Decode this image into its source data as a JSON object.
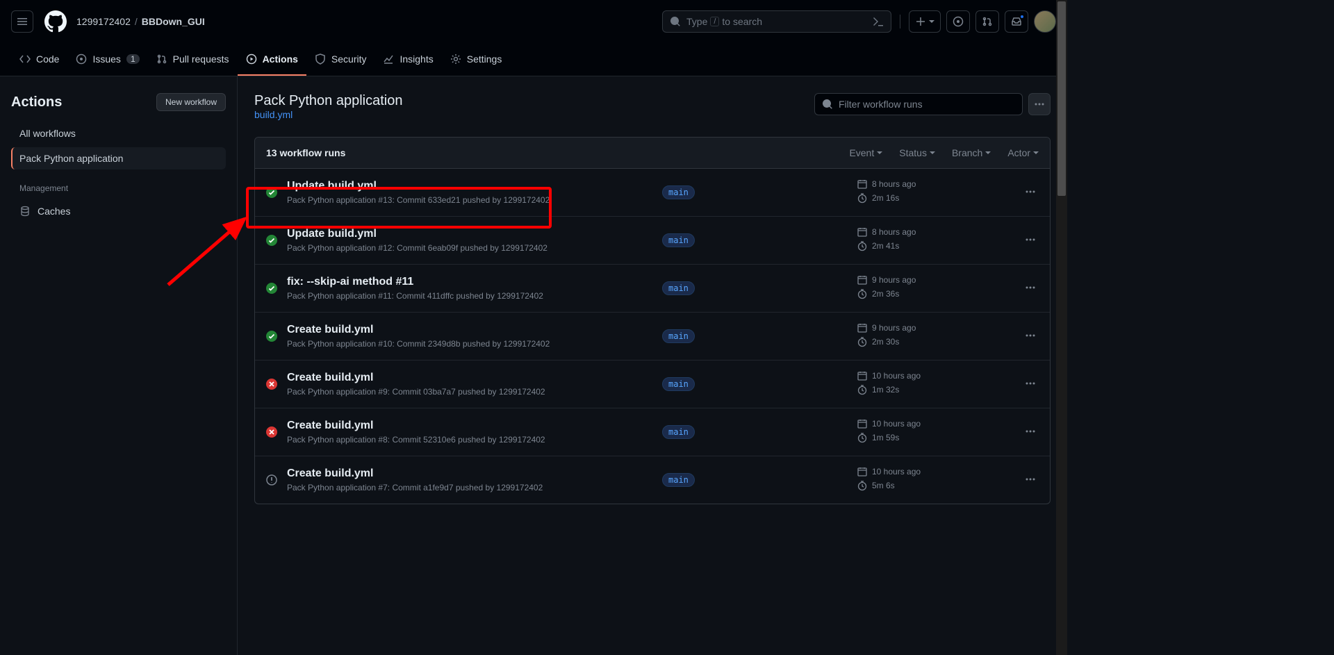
{
  "header": {
    "owner": "1299172402",
    "repo": "BBDown_GUI",
    "search_placeholder": "Type",
    "search_suffix": "to search",
    "search_key": "/"
  },
  "nav": {
    "code": "Code",
    "issues": "Issues",
    "issues_count": "1",
    "pulls": "Pull requests",
    "actions": "Actions",
    "security": "Security",
    "insights": "Insights",
    "settings": "Settings"
  },
  "sidebar": {
    "title": "Actions",
    "new_workflow": "New workflow",
    "all_workflows": "All workflows",
    "selected_workflow": "Pack Python application",
    "management": "Management",
    "caches": "Caches"
  },
  "content": {
    "title": "Pack Python application",
    "file": "build.yml",
    "filter_placeholder": "Filter workflow runs",
    "runs_count": "13 workflow runs",
    "filters": {
      "event": "Event",
      "status": "Status",
      "branch": "Branch",
      "actor": "Actor"
    }
  },
  "runs": [
    {
      "status": "success",
      "title": "Update build.yml",
      "workflow": "Pack Python application",
      "run_no": "#13",
      "commit": "633ed21",
      "pusher": "1299172402",
      "branch": "main",
      "time": "8 hours ago",
      "duration": "2m 16s"
    },
    {
      "status": "success",
      "title": "Update build.yml",
      "workflow": "Pack Python application",
      "run_no": "#12",
      "commit": "6eab09f",
      "pusher": "1299172402",
      "branch": "main",
      "time": "8 hours ago",
      "duration": "2m 41s"
    },
    {
      "status": "success",
      "title": "fix: --skip-ai method #11",
      "workflow": "Pack Python application",
      "run_no": "#11",
      "commit": "411dffc",
      "pusher": "1299172402",
      "branch": "main",
      "time": "9 hours ago",
      "duration": "2m 36s"
    },
    {
      "status": "success",
      "title": "Create build.yml",
      "workflow": "Pack Python application",
      "run_no": "#10",
      "commit": "2349d8b",
      "pusher": "1299172402",
      "branch": "main",
      "time": "9 hours ago",
      "duration": "2m 30s"
    },
    {
      "status": "failure",
      "title": "Create build.yml",
      "workflow": "Pack Python application",
      "run_no": "#9",
      "commit": "03ba7a7",
      "pusher": "1299172402",
      "branch": "main",
      "time": "10 hours ago",
      "duration": "1m 32s"
    },
    {
      "status": "failure",
      "title": "Create build.yml",
      "workflow": "Pack Python application",
      "run_no": "#8",
      "commit": "52310e6",
      "pusher": "1299172402",
      "branch": "main",
      "time": "10 hours ago",
      "duration": "1m 59s"
    },
    {
      "status": "cancelled",
      "title": "Create build.yml",
      "workflow": "Pack Python application",
      "run_no": "#7",
      "commit": "a1fe9d7",
      "pusher": "1299172402",
      "branch": "main",
      "time": "10 hours ago",
      "duration": "5m 6s"
    }
  ]
}
